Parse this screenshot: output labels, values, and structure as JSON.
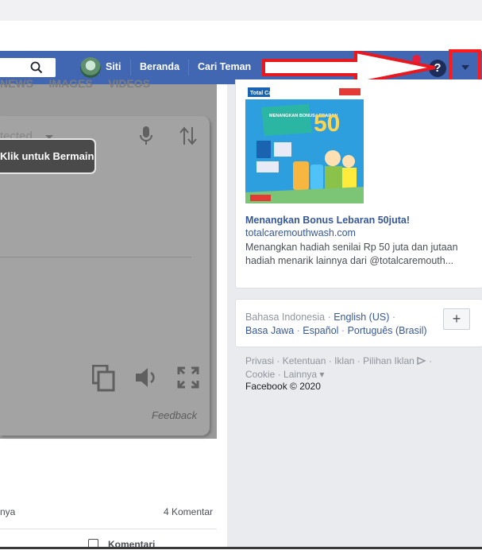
{
  "topbar": {
    "user_name": "Siti",
    "nav_home": "Beranda",
    "nav_find_friends": "Cari Teman",
    "help_symbol": "?"
  },
  "left": {
    "tabs_fragment": "NEWS     IMAGES     VIDEOS",
    "detected_fragment": "tected",
    "tooltip": "Klik untuk Bermain",
    "feedback": "Feedback",
    "likes_fragment": "nya",
    "comments_count": "4 Komentar",
    "comment_button": "Komentari"
  },
  "ad": {
    "title": "Menangkan Bonus Lebaran 50juta!",
    "domain": "totalcaremouthwash.com",
    "description": "Menangkan hadiah senilai Rp 50 juta dan jutaan hadiah menarik lainnya dari @totalcaremouth...",
    "image_headline": "MENANGKAN BONUS LEBARAN",
    "image_amount": "50",
    "image_brand": "Total Care"
  },
  "languages": {
    "current": "Bahasa Indonesia",
    "items": [
      "English (US)",
      "Basa Jawa",
      "Español",
      "Português (Brasil)"
    ],
    "add_label": "+"
  },
  "footer": {
    "links": [
      "Privasi",
      "Ketentuan",
      "Iklan",
      "Pilihan Iklan",
      "Cookie",
      "Lainnya"
    ],
    "copyright": "Facebook © 2020"
  },
  "colors": {
    "fb_blue": "#4267b2",
    "annotation_red": "#ff1a1a",
    "link_blue": "#365899"
  }
}
